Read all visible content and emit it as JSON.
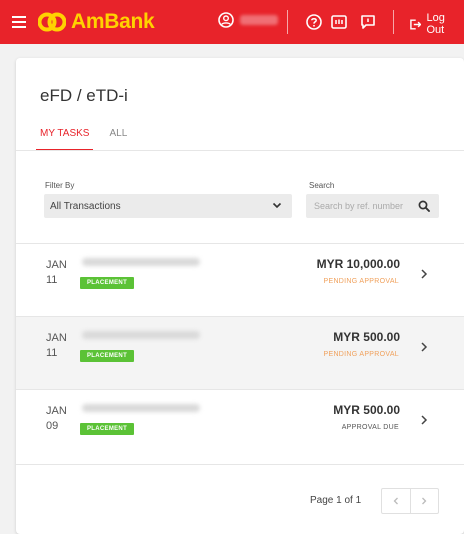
{
  "header": {
    "brand": "AmBank",
    "logout_label": "Log Out",
    "brand_color": "#e8232a",
    "logo_color": "#ffd200"
  },
  "page": {
    "title": "eFD / eTD-i",
    "tabs": [
      {
        "label": "MY TASKS",
        "active": true
      },
      {
        "label": "ALL",
        "active": false
      }
    ]
  },
  "filters": {
    "filter_label": "Filter By",
    "filter_value": "All Transactions",
    "search_label": "Search",
    "search_placeholder": "Search by ref. number"
  },
  "transactions": [
    {
      "month": "JAN",
      "day": "11",
      "type": "PLACEMENT",
      "amount": "MYR 10,000.00",
      "status": "PENDING APPROVAL"
    },
    {
      "month": "JAN",
      "day": "11",
      "type": "PLACEMENT",
      "amount": "MYR 500.00",
      "status": "PENDING APPROVAL"
    },
    {
      "month": "JAN",
      "day": "09",
      "type": "PLACEMENT",
      "amount": "MYR 500.00",
      "status": "APPROVAL DUE"
    }
  ],
  "pagination": {
    "label": "Page 1 of 1",
    "prev_icon": "chevron-left-icon",
    "next_icon": "chevron-right-icon"
  },
  "colors": {
    "badge": "#5bc236",
    "pending_status": "#f0a15c",
    "accent": "#e8232a"
  }
}
